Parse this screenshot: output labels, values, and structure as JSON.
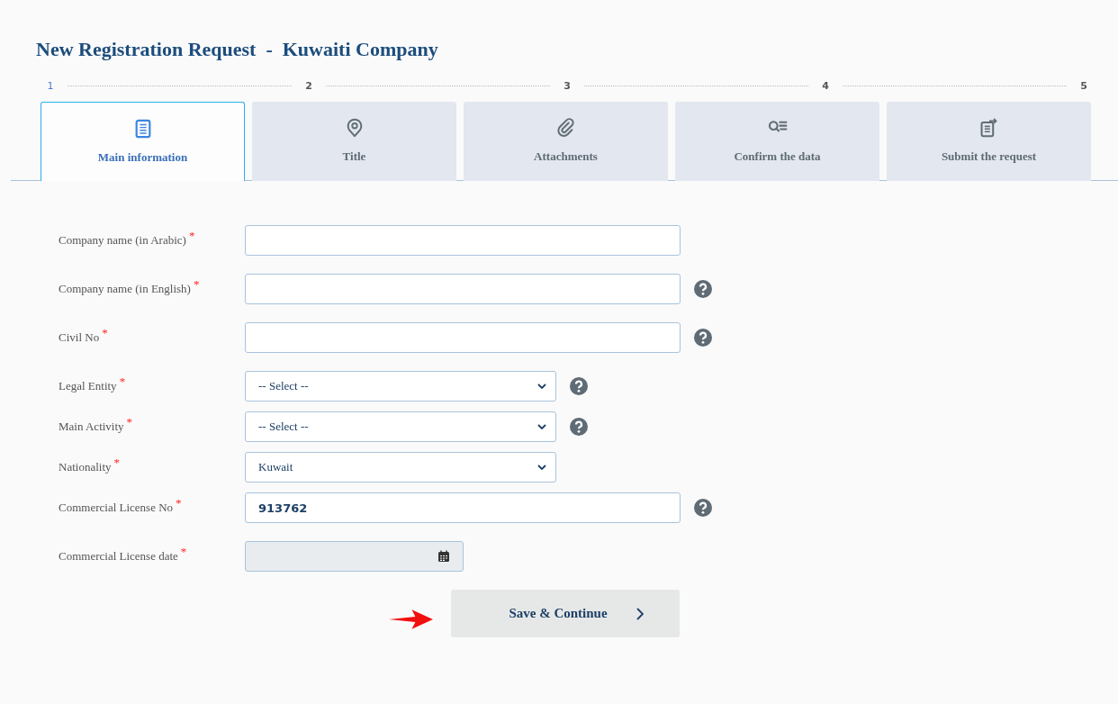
{
  "title": "New Registration Request  -  Kuwaiti Company",
  "steps": [
    {
      "number": "1",
      "label": "Main information",
      "selected": true
    },
    {
      "number": "2",
      "label": "Title",
      "selected": false
    },
    {
      "number": "3",
      "label": "Attachments",
      "selected": false
    },
    {
      "number": "4",
      "label": "Confirm the data",
      "selected": false
    },
    {
      "number": "5",
      "label": "Submit the request",
      "selected": false
    }
  ],
  "fields": [
    {
      "kind": "text",
      "label": "Company name (in Arabic)",
      "required_mark": "*",
      "help": false
    },
    {
      "kind": "text",
      "label": "Company name (in English)",
      "required_mark": "*",
      "help": true
    },
    {
      "kind": "text",
      "label": "Civil No",
      "required_mark": "*",
      "help": true
    },
    {
      "kind": "select",
      "label": "Legal Entity",
      "required_mark": "*",
      "help": true,
      "value": "-- Select --"
    },
    {
      "kind": "select",
      "label": "Main Activity",
      "required_mark": "*",
      "help": true,
      "value": "-- Select --"
    },
    {
      "kind": "select",
      "label": "Nationality",
      "required_mark": "*",
      "help": false,
      "value": "Kuwait"
    },
    {
      "kind": "text",
      "label": "Commercial License No",
      "required_mark": "*",
      "help": true,
      "value": "913762"
    },
    {
      "kind": "date",
      "label": "Commercial License date",
      "required_mark": "*",
      "help": false,
      "disabled": true
    }
  ],
  "save_button": {
    "label": "Save & Continue"
  }
}
